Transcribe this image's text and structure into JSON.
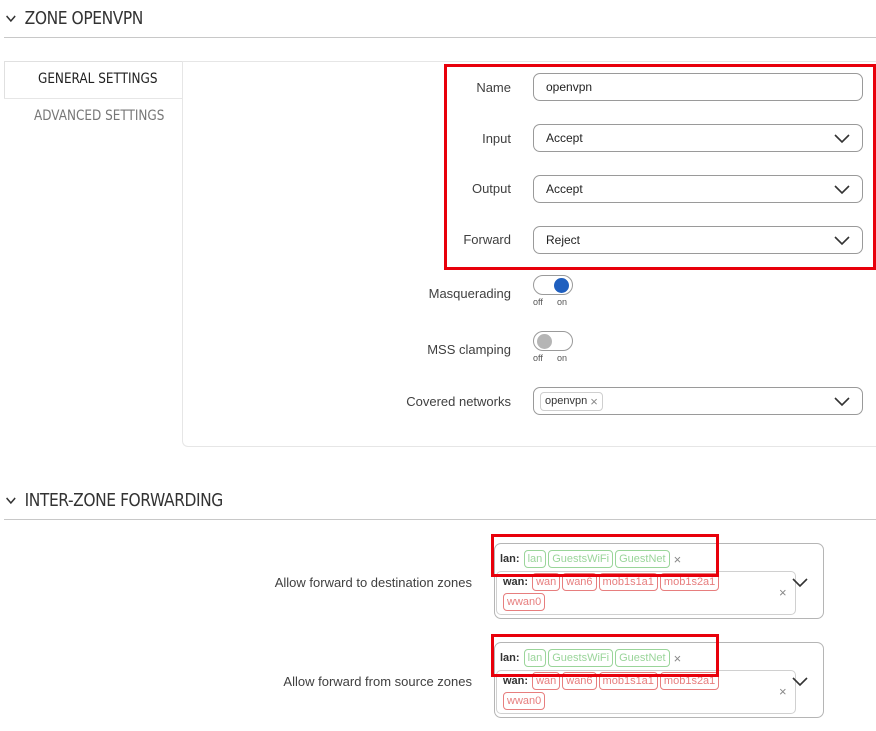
{
  "zone": {
    "title": "ZONE OPENVPN"
  },
  "tabs": [
    {
      "label": "GENERAL SETTINGS"
    },
    {
      "label": "ADVANCED SETTINGS"
    }
  ],
  "form": {
    "name": {
      "label": "Name",
      "value": "openvpn"
    },
    "input": {
      "label": "Input",
      "value": "Accept"
    },
    "output": {
      "label": "Output",
      "value": "Accept"
    },
    "forward": {
      "label": "Forward",
      "value": "Reject"
    },
    "masquerading": {
      "label": "Masquerading",
      "off": "off",
      "on": "on",
      "state": "on"
    },
    "mss_clamping": {
      "label": "MSS clamping",
      "off": "off",
      "on": "on",
      "state": "off"
    },
    "covered_networks": {
      "label": "Covered networks",
      "chip": "openvpn"
    }
  },
  "forwarding": {
    "title": "INTER-ZONE FORWARDING",
    "destination": {
      "label": "Allow forward to destination zones",
      "lan": {
        "name": "lan:",
        "chips": [
          "lan",
          "GuestsWiFi",
          "GuestNet"
        ]
      },
      "wan": {
        "name": "wan:",
        "chips": [
          "wan",
          "wan6",
          "mob1s1a1",
          "mob1s2a1",
          "wwan0"
        ]
      }
    },
    "source": {
      "label": "Allow forward from source zones",
      "lan": {
        "name": "lan:",
        "chips": [
          "lan",
          "GuestsWiFi",
          "GuestNet"
        ]
      },
      "wan": {
        "name": "wan:",
        "chips": [
          "wan",
          "wan6",
          "mob1s1a1",
          "mob1s2a1",
          "wwan0"
        ]
      }
    }
  },
  "colors": {
    "highlight": "#e8000b",
    "toggle_on": "#1f5fbf",
    "chip_green": "#9ad59a",
    "chip_red": "#e77e7e"
  },
  "icons": {
    "section_toggle": "chevron-down-icon",
    "dropdown": "chevron-down-icon",
    "remove": "close-icon"
  }
}
